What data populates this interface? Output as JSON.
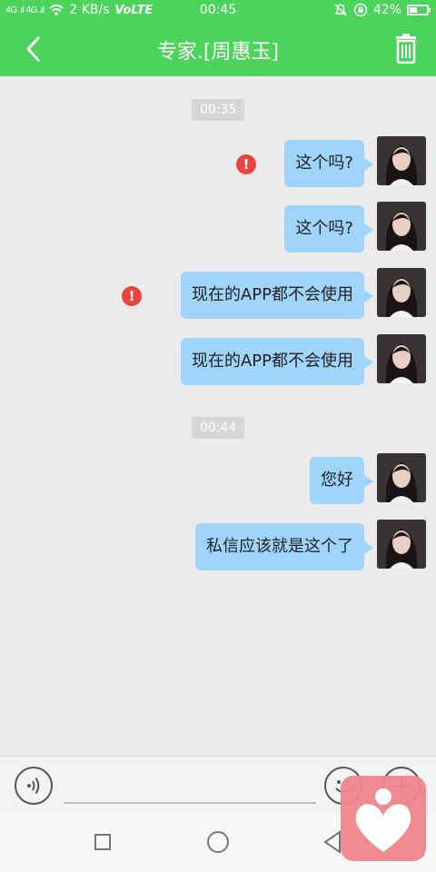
{
  "status_bar": {
    "signal_text": "4G .ıl 4G .ıl",
    "speed": "2 KB/s",
    "network": "VoLTE",
    "time": "00:45",
    "battery": "42%",
    "battery_level": 0.42
  },
  "header": {
    "title": "专家.[周惠玉]",
    "back_icon": "chevron-left-icon",
    "delete_icon": "trash-icon"
  },
  "chat": {
    "timestamps": [
      "00:35",
      "00:44"
    ],
    "messages": [
      {
        "text": "这个吗?",
        "failed": true
      },
      {
        "text": "这个吗?",
        "failed": false
      },
      {
        "text": "现在的APP都不会使用",
        "failed": true
      },
      {
        "text": "现在的APP都不会使用",
        "failed": false
      },
      {
        "text": "您好",
        "failed": false
      },
      {
        "text": "私信应该就是这个了",
        "failed": false
      }
    ],
    "error_glyph": "!"
  },
  "input_bar": {
    "placeholder": "",
    "icons": [
      "voice-icon",
      "emoji-icon",
      "plus-icon"
    ]
  },
  "nav_bar": {
    "icons": [
      "recents-square-icon",
      "home-circle-icon",
      "back-triangle-icon"
    ]
  },
  "colors": {
    "accent_green": "#4cd35b",
    "bubble_blue": "#9fd4fb",
    "error_red": "#e8463a",
    "background": "#ebebeb",
    "floater_pink": "#f0868d"
  }
}
